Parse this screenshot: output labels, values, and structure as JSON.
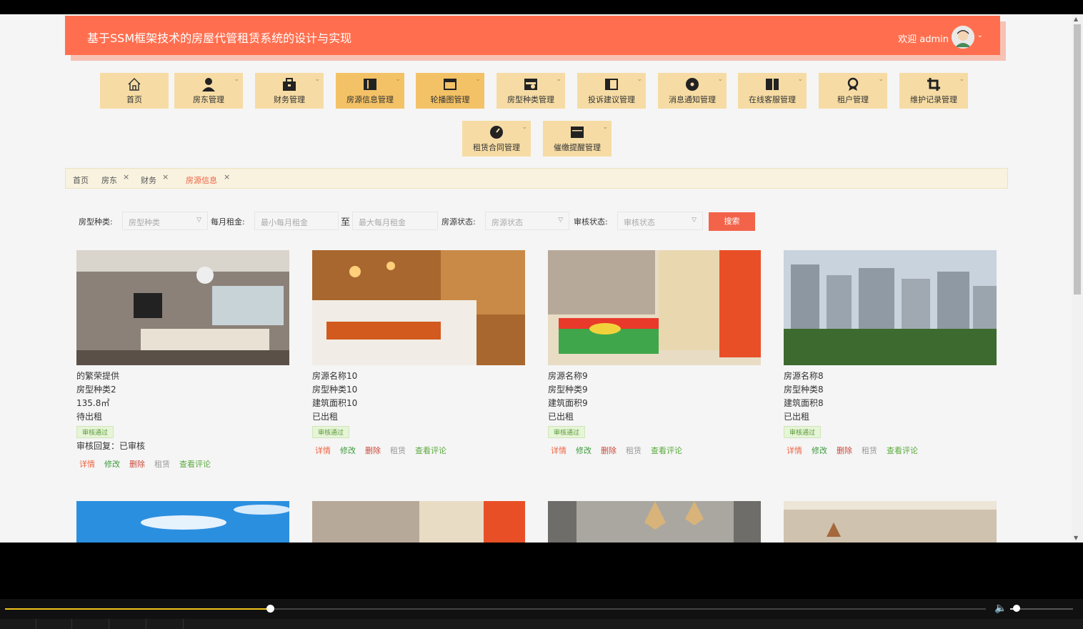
{
  "header": {
    "title": "基于SSM框架技术的房屋代管租赁系统的设计与实现",
    "welcome": "欢迎 admin"
  },
  "menu": [
    {
      "label": "首页",
      "icon": "home-icon"
    },
    {
      "label": "房东管理",
      "icon": "user-icon"
    },
    {
      "label": "财务管理",
      "icon": "briefcase-icon"
    },
    {
      "label": "房源信息管理",
      "icon": "columns-icon"
    },
    {
      "label": "轮播图管理",
      "icon": "window-icon"
    },
    {
      "label": "房型种类管理",
      "icon": "camera-icon"
    },
    {
      "label": "投诉建议管理",
      "icon": "panel-icon"
    },
    {
      "label": "消息通知管理",
      "icon": "record-icon"
    },
    {
      "label": "在线客服管理",
      "icon": "split-icon"
    },
    {
      "label": "租户管理",
      "icon": "badge-icon"
    },
    {
      "label": "维护记录管理",
      "icon": "crop-icon"
    },
    {
      "label": "租赁合同管理",
      "icon": "gauge-icon"
    },
    {
      "label": "催缴提醒管理",
      "icon": "box-icon"
    }
  ],
  "tabs": [
    "首页",
    "房东",
    "财务",
    "房源信息"
  ],
  "search": {
    "type_label": "房型种类:",
    "type_placeholder": "房型种类",
    "rent_label": "每月租金:",
    "rent_min_placeholder": "最小每月租金",
    "rent_to": "至",
    "rent_max_placeholder": "最大每月租金",
    "status_label": "房源状态:",
    "status_placeholder": "房源状态",
    "audit_label": "审核状态:",
    "audit_placeholder": "审核状态",
    "button": "搜索"
  },
  "cards": [
    {
      "name": "的繁荣提供",
      "type": "房型种类2",
      "area": "135.8㎡",
      "status": "待出租",
      "badge": "审核通过",
      "reply": "审核回复：已审核"
    },
    {
      "name": "房源名称10",
      "type": "房型种类10",
      "area": "建筑面积10",
      "status": "已出租",
      "badge": "审核通过",
      "reply": ""
    },
    {
      "name": "房源名称9",
      "type": "房型种类9",
      "area": "建筑面积9",
      "status": "已出租",
      "badge": "审核通过",
      "reply": ""
    },
    {
      "name": "房源名称8",
      "type": "房型种类8",
      "area": "建筑面积8",
      "status": "已出租",
      "badge": "审核通过",
      "reply": ""
    }
  ],
  "actions": {
    "detail": "详情",
    "edit": "修改",
    "delete": "删除",
    "rent": "租赁",
    "comment": "查看评论"
  },
  "player": {
    "progress": 0.27,
    "volume": 0.1
  }
}
